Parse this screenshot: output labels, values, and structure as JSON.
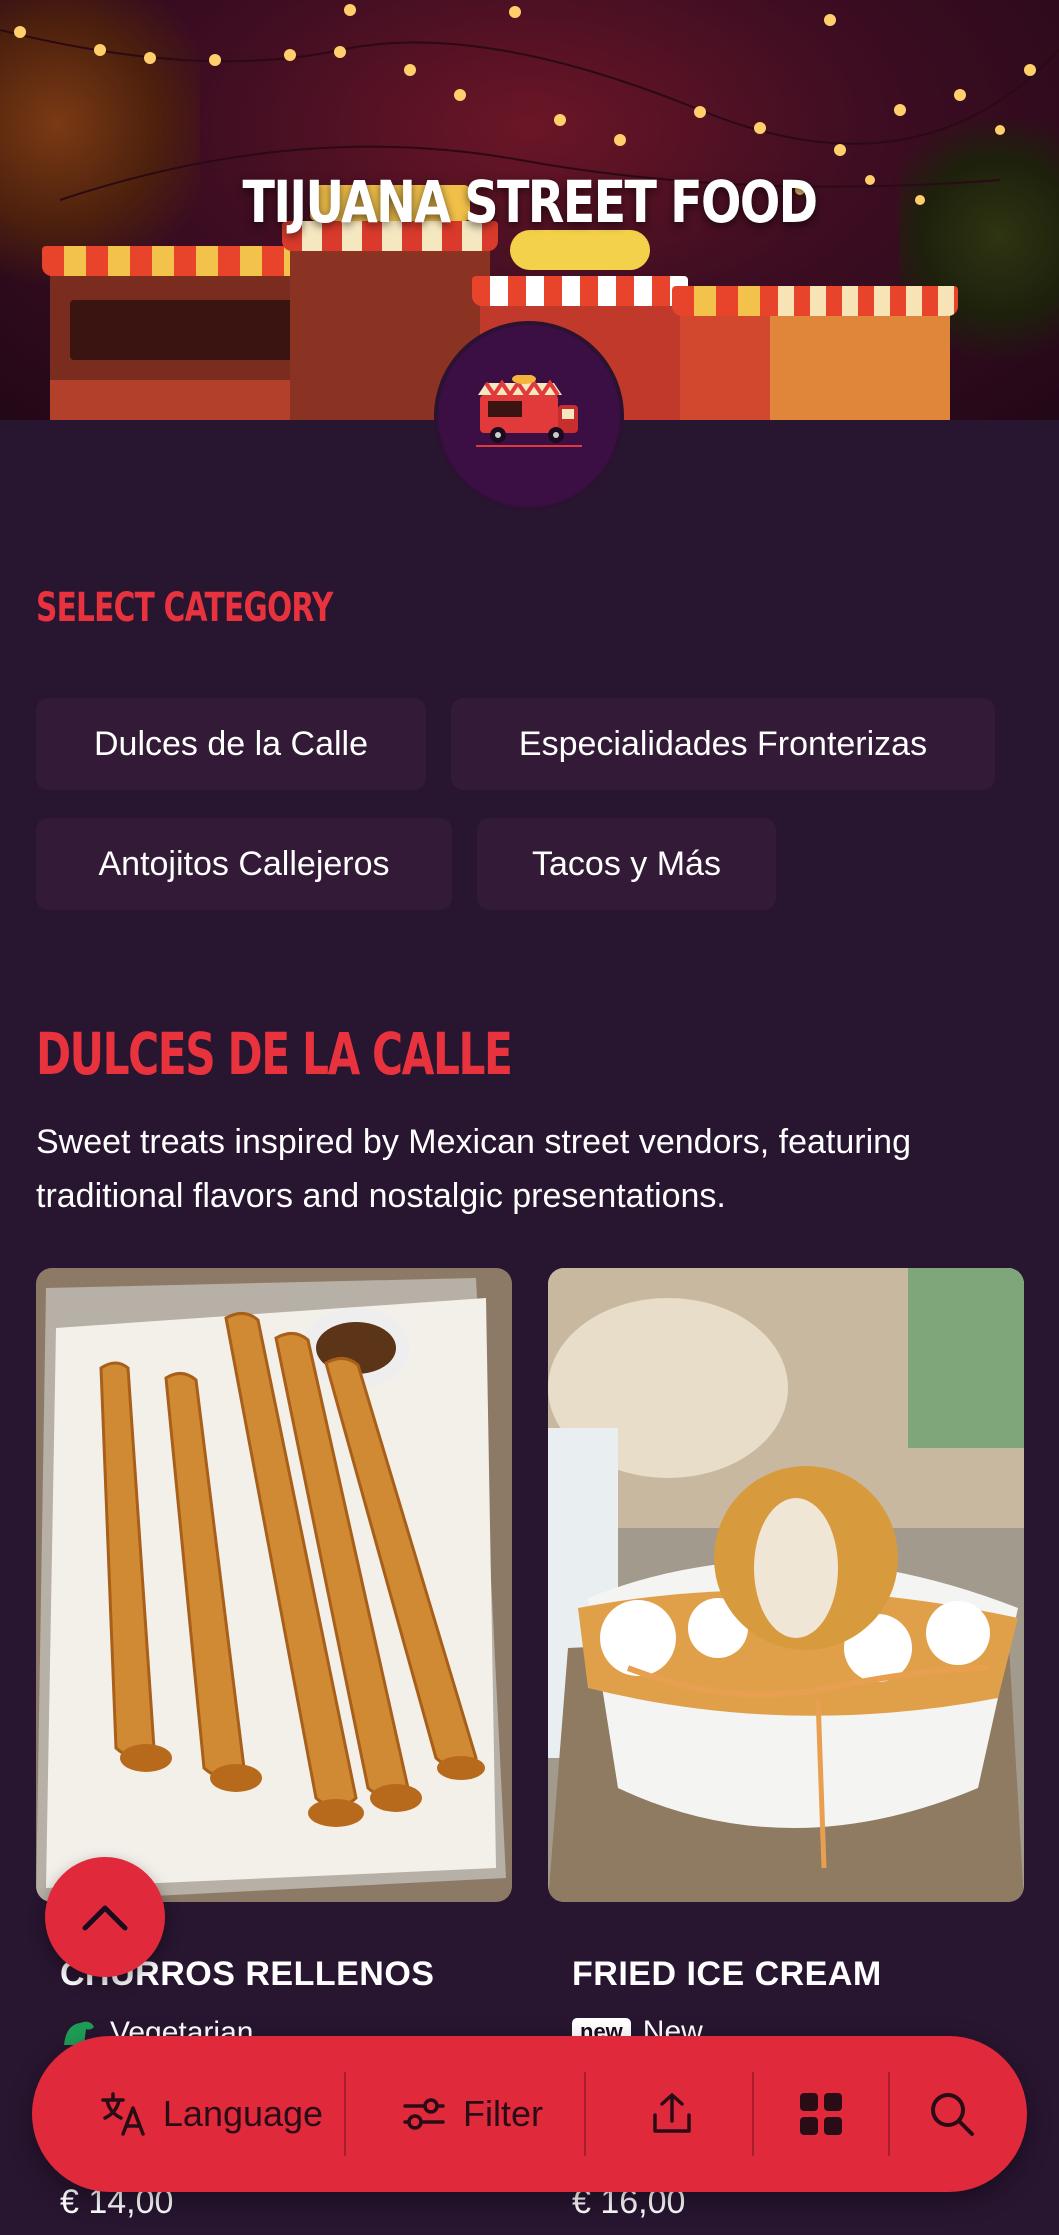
{
  "hero": {
    "title": "TIJUANA STREET FOOD",
    "logo_icon": "food-truck-logo"
  },
  "category": {
    "label": "SELECT CATEGORY",
    "chips": [
      "Dulces de la Calle",
      "Especialidades Fronterizas",
      "Antojitos Callejeros",
      "Tacos y Más"
    ]
  },
  "section": {
    "title": "DULCES DE LA CALLE",
    "description": "Sweet treats inspired by Mexican street vendors, featuring traditional flavors and nostalgic presentations."
  },
  "products": [
    {
      "name": "CHURROS RELLENOS",
      "tag": "Vegetarian",
      "tag_icon": "vegetarian-dino-icon",
      "price": "€ 14,00"
    },
    {
      "name": "FRIED ICE CREAM",
      "tag": "New",
      "tag_badge": "new",
      "price": "€ 16,00"
    }
  ],
  "toolbar": {
    "language_label": "Language",
    "filter_label": "Filter",
    "share_icon": "share-icon",
    "grid_icon": "grid-icon",
    "search_icon": "search-icon"
  },
  "colors": {
    "background": "#281530",
    "accent": "#e02a3b",
    "heading_red": "#e8333f",
    "chip_bg": "#331a36"
  }
}
